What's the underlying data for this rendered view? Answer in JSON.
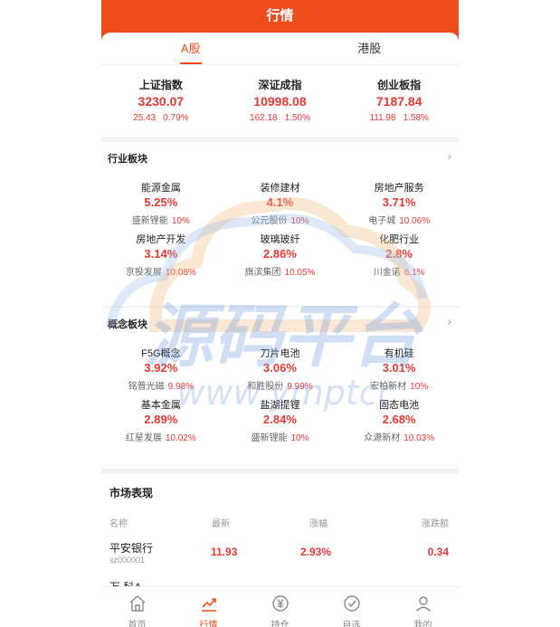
{
  "header": {
    "title": "行情"
  },
  "tabs": [
    {
      "label": "A股",
      "active": true
    },
    {
      "label": "港股",
      "active": false
    }
  ],
  "indices": [
    {
      "name": "上证指数",
      "value": "3230.07",
      "change": "25.43",
      "percent": "0.79%"
    },
    {
      "name": "深证成指",
      "value": "10998.08",
      "change": "162.18",
      "percent": "1.50%"
    },
    {
      "name": "创业板指",
      "value": "7187.84",
      "change": "111.98",
      "percent": "1.58%"
    }
  ],
  "industry": {
    "title": "行业板块",
    "items": [
      {
        "name": "能源金属",
        "pct": "5.25%",
        "stock": "盛新锂能",
        "stock_pct": "10%"
      },
      {
        "name": "装修建材",
        "pct": "4.1%",
        "stock": "公元股份",
        "stock_pct": "10%"
      },
      {
        "name": "房地产服务",
        "pct": "3.71%",
        "stock": "电子城",
        "stock_pct": "10.06%"
      },
      {
        "name": "房地产开发",
        "pct": "3.14%",
        "stock": "京投发展",
        "stock_pct": "10.08%"
      },
      {
        "name": "玻璃玻纤",
        "pct": "2.86%",
        "stock": "旗滨集团",
        "stock_pct": "10.05%"
      },
      {
        "name": "化肥行业",
        "pct": "2.8%",
        "stock": "川金诺",
        "stock_pct": "6.1%"
      }
    ]
  },
  "concept": {
    "title": "概念板块",
    "items": [
      {
        "name": "F5G概念",
        "pct": "3.92%",
        "stock": "铭普光磁",
        "stock_pct": "9.98%"
      },
      {
        "name": "刀片电池",
        "pct": "3.06%",
        "stock": "和胜股份",
        "stock_pct": "9.99%"
      },
      {
        "name": "有机硅",
        "pct": "3.01%",
        "stock": "宏柏新材",
        "stock_pct": "10%"
      },
      {
        "name": "基本金属",
        "pct": "2.89%",
        "stock": "红星发展",
        "stock_pct": "10.02%"
      },
      {
        "name": "盐湖提锂",
        "pct": "2.84%",
        "stock": "盛新锂能",
        "stock_pct": "10%"
      },
      {
        "name": "固态电池",
        "pct": "2.68%",
        "stock": "众源新材",
        "stock_pct": "10.03%"
      }
    ]
  },
  "market": {
    "title": "市场表现",
    "columns": {
      "name": "名称",
      "latest": "最新",
      "change_pct": "涨幅",
      "change": "涨跌额"
    },
    "rows": [
      {
        "name": "平安银行",
        "code": "sz000001",
        "latest": "11.93",
        "pct": "2.93%",
        "change": "0.34"
      },
      {
        "name": "万 科A",
        "code": "",
        "latest": "",
        "pct": "",
        "change": ""
      }
    ]
  },
  "watermark": {
    "main": "源码平台",
    "sub": "www.ymptcc"
  },
  "tabbar": [
    {
      "label": "首页",
      "icon": "home-icon",
      "active": false
    },
    {
      "label": "行情",
      "icon": "chart-icon",
      "active": true
    },
    {
      "label": "持仓",
      "icon": "yuan-icon",
      "active": false
    },
    {
      "label": "自选",
      "icon": "check-circle-icon",
      "active": false
    },
    {
      "label": "我的",
      "icon": "user-icon",
      "active": false
    }
  ],
  "colors": {
    "brand": "#f04b1c",
    "up": "#e53935",
    "background": "#f3f3f5"
  }
}
